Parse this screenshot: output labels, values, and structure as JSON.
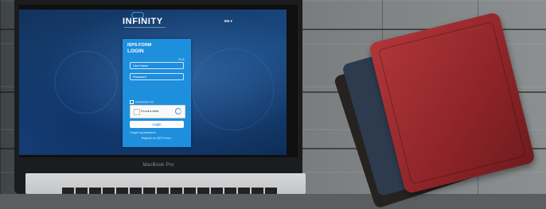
{
  "device": {
    "label": "MacBook Pro"
  },
  "header": {
    "logo_text": "INFINITY",
    "language": "EN ▾"
  },
  "login": {
    "subtitle": "ISPS FORM",
    "title": "LOGIN",
    "idle_link": "IDLE",
    "username_placeholder": "User Name",
    "password_placeholder": "Password",
    "remember_label": "Remember me",
    "captcha_label": "I'm not a robot",
    "login_button": "Login",
    "forgot_link": "I forgot my password",
    "register_link": "Register for ISPS Form ›"
  }
}
